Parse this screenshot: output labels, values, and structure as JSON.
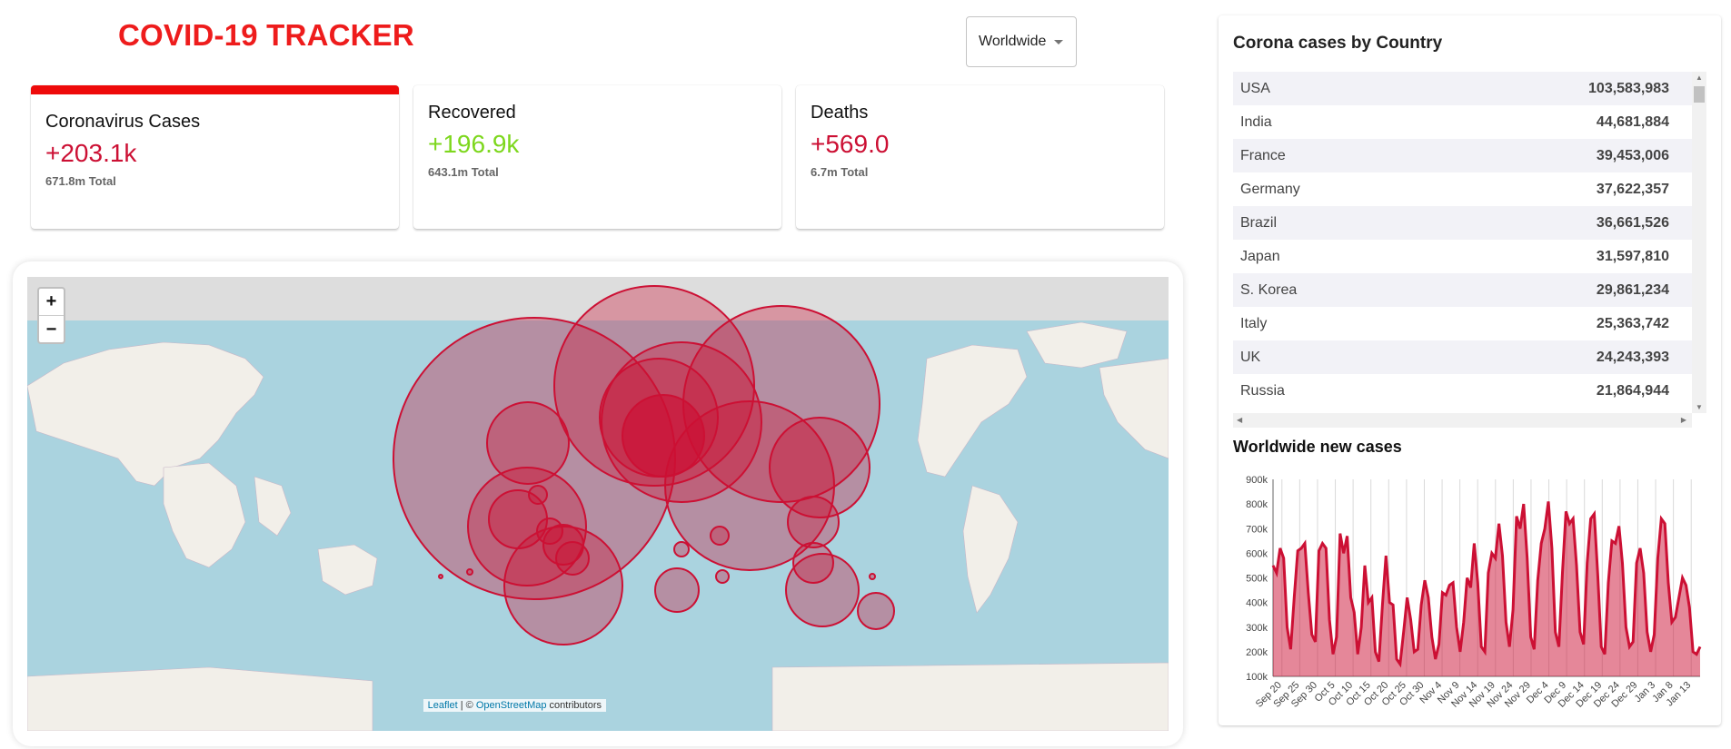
{
  "header": {
    "title": "COVID-19 TRACKER",
    "country_select": "Worldwide"
  },
  "colors": {
    "accent": "#cc1034",
    "title": "#ee1c1c",
    "recovered": "#7dd71d",
    "circle_fill": "#cc1034",
    "ocean": "#aad3df",
    "land": "#f2efe9"
  },
  "cards": [
    {
      "title": "Coronavirus Cases",
      "cases": "+203.1k",
      "total": "671.8m Total",
      "selected": true
    },
    {
      "title": "Recovered",
      "cases": "+196.9k",
      "total": "643.1m Total",
      "selected": false
    },
    {
      "title": "Deaths",
      "cases": "+569.0",
      "total": "6.7m Total",
      "selected": false
    }
  ],
  "map": {
    "zoom_in": "+",
    "zoom_out": "−",
    "attribution": {
      "leaflet": "Leaflet",
      "sep": " | © ",
      "osm": "OpenStreetMap",
      "suffix": " contributors"
    },
    "icons": [
      "zoom-in-icon",
      "zoom-out-icon"
    ]
  },
  "sidebar": {
    "heading": "Corona cases by Country",
    "table": [
      {
        "country": "USA",
        "cases": "103,583,983"
      },
      {
        "country": "India",
        "cases": "44,681,884"
      },
      {
        "country": "France",
        "cases": "39,453,006"
      },
      {
        "country": "Germany",
        "cases": "37,622,357"
      },
      {
        "country": "Brazil",
        "cases": "36,661,526"
      },
      {
        "country": "Japan",
        "cases": "31,597,810"
      },
      {
        "country": "S. Korea",
        "cases": "29,861,234"
      },
      {
        "country": "Italy",
        "cases": "25,363,742"
      },
      {
        "country": "UK",
        "cases": "24,243,393"
      },
      {
        "country": "Russia",
        "cases": "21,864,944"
      }
    ],
    "chart_title": "Worldwide new cases"
  },
  "chart_data": {
    "type": "area",
    "title": "Worldwide new cases",
    "ylabel": "",
    "xlabel": "",
    "ylim": [
      100000,
      900000
    ],
    "yticks": [
      "100k",
      "200k",
      "300k",
      "400k",
      "500k",
      "600k",
      "700k",
      "800k",
      "900k"
    ],
    "xticks": [
      "Sep 20",
      "Sep 25",
      "Sep 30",
      "Oct 5",
      "Oct 10",
      "Oct 15",
      "Oct 20",
      "Oct 25",
      "Oct 30",
      "Nov 4",
      "Nov 9",
      "Nov 14",
      "Nov 19",
      "Nov 24",
      "Nov 29",
      "Dec 4",
      "Dec 9",
      "Dec 14",
      "Dec 19",
      "Dec 24",
      "Dec 29",
      "Jan 3",
      "Jan 8",
      "Jan 13"
    ],
    "grid": "vertical",
    "series": [
      {
        "values": [
          550000,
          520000,
          620000,
          580000,
          300000,
          210000,
          420000,
          610000,
          620000,
          640000,
          440000,
          270000,
          240000,
          610000,
          640000,
          620000,
          330000,
          190000,
          260000,
          680000,
          600000,
          670000,
          420000,
          360000,
          190000,
          300000,
          550000,
          400000,
          420000,
          200000,
          160000,
          390000,
          590000,
          400000,
          390000,
          170000,
          150000,
          280000,
          420000,
          330000,
          200000,
          210000,
          390000,
          490000,
          420000,
          260000,
          170000,
          230000,
          440000,
          430000,
          470000,
          480000,
          300000,
          200000,
          320000,
          500000,
          460000,
          640000,
          480000,
          220000,
          200000,
          520000,
          600000,
          580000,
          720000,
          590000,
          320000,
          220000,
          370000,
          750000,
          700000,
          800000,
          580000,
          260000,
          210000,
          490000,
          640000,
          700000,
          810000,
          620000,
          280000,
          220000,
          520000,
          770000,
          720000,
          740000,
          550000,
          280000,
          230000,
          560000,
          740000,
          760000,
          510000,
          220000,
          190000,
          480000,
          650000,
          640000,
          710000,
          560000,
          300000,
          220000,
          240000,
          560000,
          620000,
          520000,
          280000,
          200000,
          270000,
          580000,
          740000,
          720000,
          480000,
          320000,
          340000,
          420000,
          500000,
          470000,
          380000,
          200000,
          190000,
          220000
        ]
      }
    ]
  }
}
